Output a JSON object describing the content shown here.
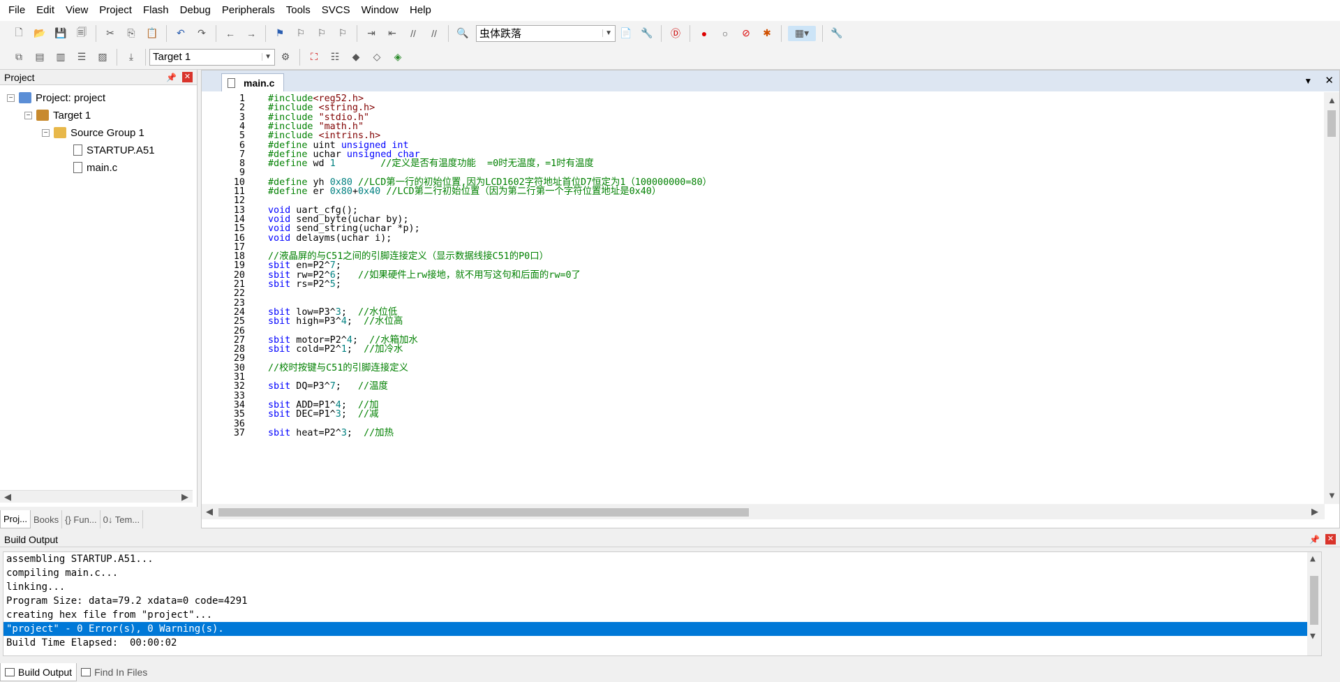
{
  "menu": [
    "File",
    "Edit",
    "View",
    "Project",
    "Flash",
    "Debug",
    "Peripherals",
    "Tools",
    "SVCS",
    "Window",
    "Help"
  ],
  "toolbar": {
    "font_combo": "虫体跌落",
    "target_combo": "Target 1"
  },
  "project_panel": {
    "title": "Project",
    "tree": {
      "project": "Project: project",
      "target": "Target 1",
      "group": "Source Group 1",
      "files": [
        "STARTUP.A51",
        "main.c"
      ]
    },
    "tabs": [
      "Proj...",
      "Books",
      "{} Fun...",
      "0↓ Tem..."
    ]
  },
  "editor": {
    "tab": "main.c",
    "lines": [
      {
        "n": "1",
        "t": [
          {
            "c": "pp",
            "s": "#include"
          },
          {
            "c": "str",
            "s": "<reg52.h>"
          }
        ]
      },
      {
        "n": "2",
        "t": [
          {
            "c": "pp",
            "s": "#include "
          },
          {
            "c": "str",
            "s": "<string.h>"
          }
        ]
      },
      {
        "n": "3",
        "t": [
          {
            "c": "pp",
            "s": "#include "
          },
          {
            "c": "str",
            "s": "\"stdio.h\""
          }
        ]
      },
      {
        "n": "4",
        "t": [
          {
            "c": "pp",
            "s": "#include "
          },
          {
            "c": "str",
            "s": "\"math.h\""
          }
        ]
      },
      {
        "n": "5",
        "t": [
          {
            "c": "pp",
            "s": "#include "
          },
          {
            "c": "str",
            "s": "<intrins.h>"
          }
        ]
      },
      {
        "n": "6",
        "t": [
          {
            "c": "pp",
            "s": "#define "
          },
          {
            "c": "",
            "s": "uint "
          },
          {
            "c": "kw",
            "s": "unsigned int"
          }
        ]
      },
      {
        "n": "7",
        "t": [
          {
            "c": "pp",
            "s": "#define "
          },
          {
            "c": "",
            "s": "uchar "
          },
          {
            "c": "kw",
            "s": "unsigned char"
          }
        ]
      },
      {
        "n": "8",
        "t": [
          {
            "c": "pp",
            "s": "#define "
          },
          {
            "c": "",
            "s": "wd "
          },
          {
            "c": "num",
            "s": "1"
          },
          {
            "c": "",
            "s": "        "
          },
          {
            "c": "cm",
            "s": "//定义是否有温度功能  =0时无温度，=1时有温度"
          }
        ]
      },
      {
        "n": "9",
        "t": []
      },
      {
        "n": "10",
        "t": [
          {
            "c": "pp",
            "s": "#define "
          },
          {
            "c": "",
            "s": "yh "
          },
          {
            "c": "num",
            "s": "0x80"
          },
          {
            "c": "",
            "s": " "
          },
          {
            "c": "cm",
            "s": "//LCD第一行的初始位置,因为LCD1602字符地址首位D7恒定为1（100000000=80）"
          }
        ]
      },
      {
        "n": "11",
        "t": [
          {
            "c": "pp",
            "s": "#define "
          },
          {
            "c": "",
            "s": "er "
          },
          {
            "c": "num",
            "s": "0x80"
          },
          {
            "c": "",
            "s": "+"
          },
          {
            "c": "num",
            "s": "0x40"
          },
          {
            "c": "",
            "s": " "
          },
          {
            "c": "cm",
            "s": "//LCD第二行初始位置（因为第二行第一个字符位置地址是0x40）"
          }
        ]
      },
      {
        "n": "12",
        "t": []
      },
      {
        "n": "13",
        "t": [
          {
            "c": "kw",
            "s": "void"
          },
          {
            "c": "",
            "s": " uart_cfg();"
          }
        ]
      },
      {
        "n": "14",
        "t": [
          {
            "c": "kw",
            "s": "void"
          },
          {
            "c": "",
            "s": " send_byte(uchar by);"
          }
        ]
      },
      {
        "n": "15",
        "t": [
          {
            "c": "kw",
            "s": "void"
          },
          {
            "c": "",
            "s": " send_string(uchar *p);"
          }
        ]
      },
      {
        "n": "16",
        "t": [
          {
            "c": "kw",
            "s": "void"
          },
          {
            "c": "",
            "s": " delayms(uchar i);"
          }
        ]
      },
      {
        "n": "17",
        "t": []
      },
      {
        "n": "18",
        "t": [
          {
            "c": "cm",
            "s": "//液晶屏的与C51之间的引脚连接定义（显示数据线接C51的P0口）"
          }
        ]
      },
      {
        "n": "19",
        "t": [
          {
            "c": "kw",
            "s": "sbit"
          },
          {
            "c": "",
            "s": " en=P2^"
          },
          {
            "c": "num",
            "s": "7"
          },
          {
            "c": "",
            "s": ";"
          }
        ]
      },
      {
        "n": "20",
        "t": [
          {
            "c": "kw",
            "s": "sbit"
          },
          {
            "c": "",
            "s": " rw=P2^"
          },
          {
            "c": "num",
            "s": "6"
          },
          {
            "c": "",
            "s": ";   "
          },
          {
            "c": "cm",
            "s": "//如果硬件上rw接地，就不用写这句和后面的rw=0了"
          }
        ]
      },
      {
        "n": "21",
        "t": [
          {
            "c": "kw",
            "s": "sbit"
          },
          {
            "c": "",
            "s": " rs=P2^"
          },
          {
            "c": "num",
            "s": "5"
          },
          {
            "c": "",
            "s": ";"
          }
        ]
      },
      {
        "n": "22",
        "t": []
      },
      {
        "n": "23",
        "t": []
      },
      {
        "n": "24",
        "t": [
          {
            "c": "kw",
            "s": "sbit"
          },
          {
            "c": "",
            "s": " low=P3^"
          },
          {
            "c": "num",
            "s": "3"
          },
          {
            "c": "",
            "s": ";  "
          },
          {
            "c": "cm",
            "s": "//水位低"
          }
        ]
      },
      {
        "n": "25",
        "t": [
          {
            "c": "kw",
            "s": "sbit"
          },
          {
            "c": "",
            "s": " high=P3^"
          },
          {
            "c": "num",
            "s": "4"
          },
          {
            "c": "",
            "s": ";  "
          },
          {
            "c": "cm",
            "s": "//水位高"
          }
        ]
      },
      {
        "n": "26",
        "t": []
      },
      {
        "n": "27",
        "t": [
          {
            "c": "kw",
            "s": "sbit"
          },
          {
            "c": "",
            "s": " motor=P2^"
          },
          {
            "c": "num",
            "s": "4"
          },
          {
            "c": "",
            "s": ";  "
          },
          {
            "c": "cm",
            "s": "//水箱加水"
          }
        ]
      },
      {
        "n": "28",
        "t": [
          {
            "c": "kw",
            "s": "sbit"
          },
          {
            "c": "",
            "s": " cold=P2^"
          },
          {
            "c": "num",
            "s": "1"
          },
          {
            "c": "",
            "s": ";  "
          },
          {
            "c": "cm",
            "s": "//加冷水"
          }
        ]
      },
      {
        "n": "29",
        "t": []
      },
      {
        "n": "30",
        "t": [
          {
            "c": "cm",
            "s": "//校时按键与C51的引脚连接定义"
          }
        ]
      },
      {
        "n": "31",
        "t": []
      },
      {
        "n": "32",
        "t": [
          {
            "c": "kw",
            "s": "sbit"
          },
          {
            "c": "",
            "s": " DQ=P3^"
          },
          {
            "c": "num",
            "s": "7"
          },
          {
            "c": "",
            "s": ";   "
          },
          {
            "c": "cm",
            "s": "//温度"
          }
        ]
      },
      {
        "n": "33",
        "t": []
      },
      {
        "n": "34",
        "t": [
          {
            "c": "kw",
            "s": "sbit"
          },
          {
            "c": "",
            "s": " ADD=P1^"
          },
          {
            "c": "num",
            "s": "4"
          },
          {
            "c": "",
            "s": ";  "
          },
          {
            "c": "cm",
            "s": "//加"
          }
        ]
      },
      {
        "n": "35",
        "t": [
          {
            "c": "kw",
            "s": "sbit"
          },
          {
            "c": "",
            "s": " DEC=P1^"
          },
          {
            "c": "num",
            "s": "3"
          },
          {
            "c": "",
            "s": ";  "
          },
          {
            "c": "cm",
            "s": "//减"
          }
        ]
      },
      {
        "n": "36",
        "t": []
      },
      {
        "n": "37",
        "t": [
          {
            "c": "kw",
            "s": "sbit"
          },
          {
            "c": "",
            "s": " heat=P2^"
          },
          {
            "c": "num",
            "s": "3"
          },
          {
            "c": "",
            "s": ";  "
          },
          {
            "c": "cm",
            "s": "//加热"
          }
        ]
      }
    ]
  },
  "build_output": {
    "title": "Build Output",
    "lines": [
      "assembling STARTUP.A51...",
      "compiling main.c...",
      "linking...",
      "Program Size: data=79.2 xdata=0 code=4291",
      "creating hex file from \"project\"...",
      "\"project\" - 0 Error(s), 0 Warning(s).",
      "Build Time Elapsed:  00:00:02"
    ],
    "selected_index": 5,
    "tabs": [
      "Build Output",
      "Find In Files"
    ]
  },
  "colors": {
    "keyword": "#0000ff",
    "comment": "#008000",
    "string": "#800000",
    "number": "#008080",
    "selection": "#0078d7"
  }
}
